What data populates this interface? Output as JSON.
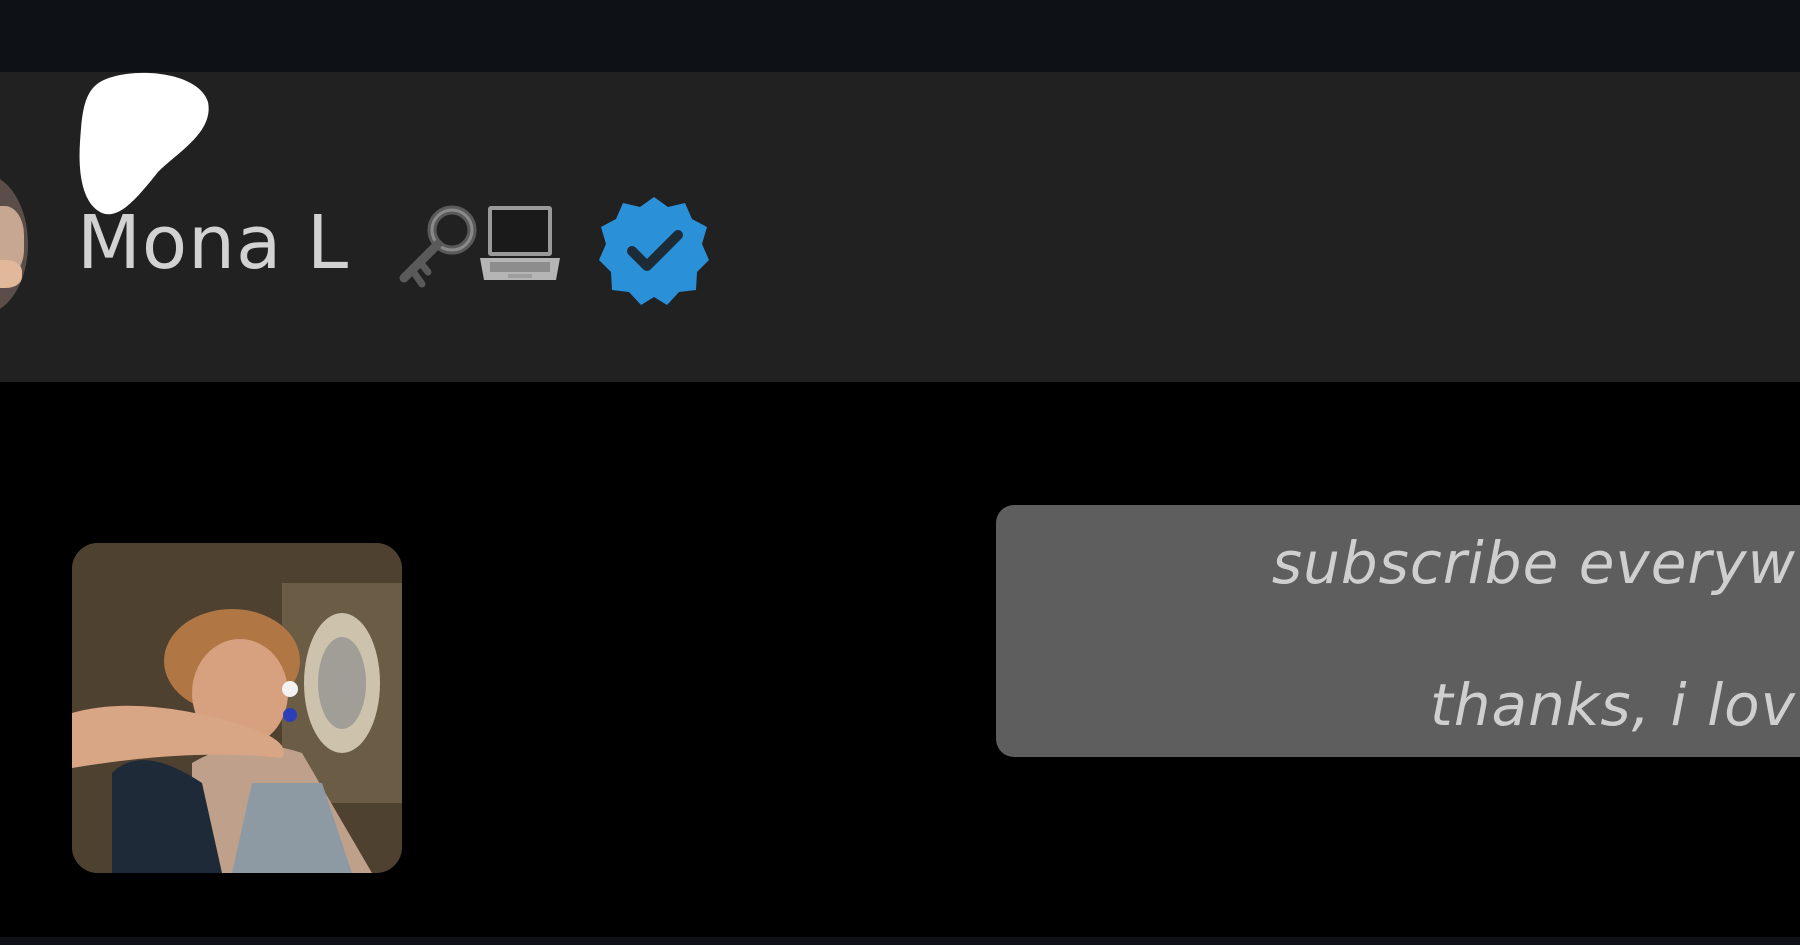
{
  "profile": {
    "display_name": "Mona L",
    "name_emojis": [
      "key-emoji",
      "laptop-emoji"
    ],
    "verified": true,
    "badge_color": "#2a91d9"
  },
  "message": {
    "lines": [
      "subscribe everyw",
      "thanks, i lov"
    ]
  },
  "colors": {
    "top_bar": "#0e1216",
    "header_bg": "#212121",
    "content_bg": "#000000",
    "bubble_bg": "#5e5e5e",
    "text": "#d2d2d2"
  }
}
